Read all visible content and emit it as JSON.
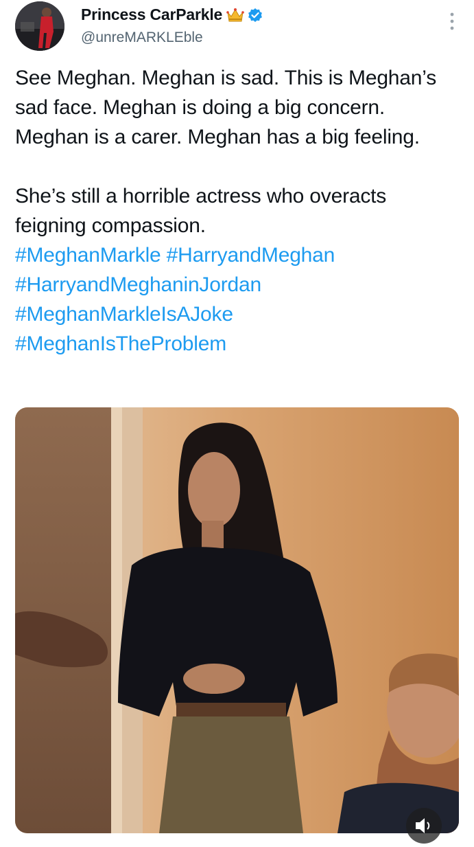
{
  "author": {
    "display_name": "Princess CarParkle",
    "handle": "@unreMARKLEble",
    "badge_emoji_icon": "crown-icon",
    "verified_icon": "verified-badge-icon",
    "accent_color": "#1d9bf0"
  },
  "tweet": {
    "paragraph1": "See Meghan. Meghan is sad. This is Meghan’s sad face. Meghan is doing a big concern. Meghan is a carer. Meghan has a big feeling.",
    "paragraph2": "She’s still a horrible actress who overacts feigning compassion.",
    "hashtags": [
      "#MeghanMarkle #HarryandMeghan",
      "#HarryandMeghaninJordan",
      "#MeghanMarkleIsAJoke",
      "#MeghanIsTheProblem"
    ]
  },
  "media": {
    "type": "video",
    "control_icon": "speaker-icon"
  },
  "menu_icon": "more-vertical-icon"
}
